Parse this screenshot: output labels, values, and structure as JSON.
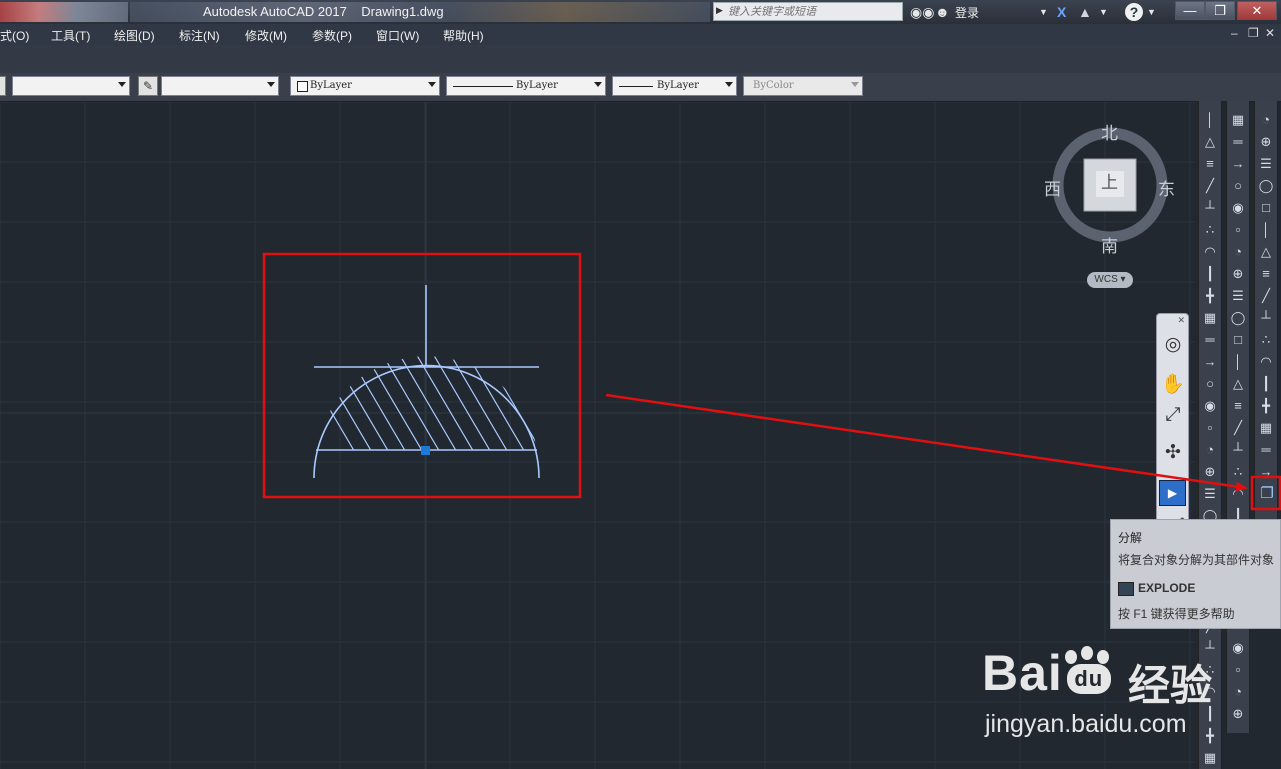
{
  "titlebar": {
    "app": "Autodesk AutoCAD 2017",
    "file": "Drawing1.dwg",
    "search_placeholder": "键入关键字或短语",
    "login": "登录"
  },
  "menu": [
    "式(O)",
    "工具(T)",
    "绘图(D)",
    "标注(N)",
    "修改(M)",
    "参数(P)",
    "窗口(W)",
    "帮助(H)"
  ],
  "properties": {
    "color": "ByLayer",
    "linetype": "ByLayer",
    "lineweight": "ByLayer",
    "plotstyle": "ByColor"
  },
  "viewcube": {
    "north": "北",
    "south": "南",
    "east": "东",
    "west": "西",
    "face": "上",
    "ucs": "WCS"
  },
  "tooltip": {
    "title": "分解",
    "description": "将复合对象分解为其部件对象",
    "command": "EXPLODE",
    "help": "按 F1 键获得更多帮助"
  },
  "colors": {
    "background": "#212830",
    "geometry": "#a9c9ff",
    "annotation": "#e01010"
  },
  "watermark": {
    "logo_latin": "Bai",
    "logo_paw_text": "du",
    "logo_cn": "经验",
    "url": "jingyan.baidu.com"
  }
}
